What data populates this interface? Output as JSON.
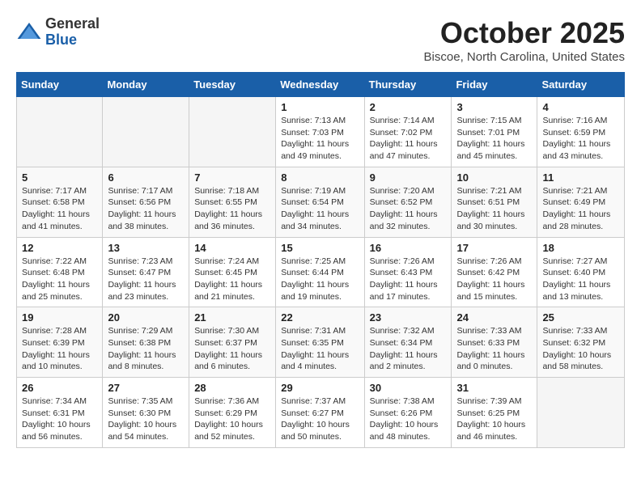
{
  "logo": {
    "general": "General",
    "blue": "Blue"
  },
  "title": "October 2025",
  "location": "Biscoe, North Carolina, United States",
  "days_of_week": [
    "Sunday",
    "Monday",
    "Tuesday",
    "Wednesday",
    "Thursday",
    "Friday",
    "Saturday"
  ],
  "weeks": [
    [
      {
        "day": "",
        "info": ""
      },
      {
        "day": "",
        "info": ""
      },
      {
        "day": "",
        "info": ""
      },
      {
        "day": "1",
        "info": "Sunrise: 7:13 AM\nSunset: 7:03 PM\nDaylight: 11 hours and 49 minutes."
      },
      {
        "day": "2",
        "info": "Sunrise: 7:14 AM\nSunset: 7:02 PM\nDaylight: 11 hours and 47 minutes."
      },
      {
        "day": "3",
        "info": "Sunrise: 7:15 AM\nSunset: 7:01 PM\nDaylight: 11 hours and 45 minutes."
      },
      {
        "day": "4",
        "info": "Sunrise: 7:16 AM\nSunset: 6:59 PM\nDaylight: 11 hours and 43 minutes."
      }
    ],
    [
      {
        "day": "5",
        "info": "Sunrise: 7:17 AM\nSunset: 6:58 PM\nDaylight: 11 hours and 41 minutes."
      },
      {
        "day": "6",
        "info": "Sunrise: 7:17 AM\nSunset: 6:56 PM\nDaylight: 11 hours and 38 minutes."
      },
      {
        "day": "7",
        "info": "Sunrise: 7:18 AM\nSunset: 6:55 PM\nDaylight: 11 hours and 36 minutes."
      },
      {
        "day": "8",
        "info": "Sunrise: 7:19 AM\nSunset: 6:54 PM\nDaylight: 11 hours and 34 minutes."
      },
      {
        "day": "9",
        "info": "Sunrise: 7:20 AM\nSunset: 6:52 PM\nDaylight: 11 hours and 32 minutes."
      },
      {
        "day": "10",
        "info": "Sunrise: 7:21 AM\nSunset: 6:51 PM\nDaylight: 11 hours and 30 minutes."
      },
      {
        "day": "11",
        "info": "Sunrise: 7:21 AM\nSunset: 6:49 PM\nDaylight: 11 hours and 28 minutes."
      }
    ],
    [
      {
        "day": "12",
        "info": "Sunrise: 7:22 AM\nSunset: 6:48 PM\nDaylight: 11 hours and 25 minutes."
      },
      {
        "day": "13",
        "info": "Sunrise: 7:23 AM\nSunset: 6:47 PM\nDaylight: 11 hours and 23 minutes."
      },
      {
        "day": "14",
        "info": "Sunrise: 7:24 AM\nSunset: 6:45 PM\nDaylight: 11 hours and 21 minutes."
      },
      {
        "day": "15",
        "info": "Sunrise: 7:25 AM\nSunset: 6:44 PM\nDaylight: 11 hours and 19 minutes."
      },
      {
        "day": "16",
        "info": "Sunrise: 7:26 AM\nSunset: 6:43 PM\nDaylight: 11 hours and 17 minutes."
      },
      {
        "day": "17",
        "info": "Sunrise: 7:26 AM\nSunset: 6:42 PM\nDaylight: 11 hours and 15 minutes."
      },
      {
        "day": "18",
        "info": "Sunrise: 7:27 AM\nSunset: 6:40 PM\nDaylight: 11 hours and 13 minutes."
      }
    ],
    [
      {
        "day": "19",
        "info": "Sunrise: 7:28 AM\nSunset: 6:39 PM\nDaylight: 11 hours and 10 minutes."
      },
      {
        "day": "20",
        "info": "Sunrise: 7:29 AM\nSunset: 6:38 PM\nDaylight: 11 hours and 8 minutes."
      },
      {
        "day": "21",
        "info": "Sunrise: 7:30 AM\nSunset: 6:37 PM\nDaylight: 11 hours and 6 minutes."
      },
      {
        "day": "22",
        "info": "Sunrise: 7:31 AM\nSunset: 6:35 PM\nDaylight: 11 hours and 4 minutes."
      },
      {
        "day": "23",
        "info": "Sunrise: 7:32 AM\nSunset: 6:34 PM\nDaylight: 11 hours and 2 minutes."
      },
      {
        "day": "24",
        "info": "Sunrise: 7:33 AM\nSunset: 6:33 PM\nDaylight: 11 hours and 0 minutes."
      },
      {
        "day": "25",
        "info": "Sunrise: 7:33 AM\nSunset: 6:32 PM\nDaylight: 10 hours and 58 minutes."
      }
    ],
    [
      {
        "day": "26",
        "info": "Sunrise: 7:34 AM\nSunset: 6:31 PM\nDaylight: 10 hours and 56 minutes."
      },
      {
        "day": "27",
        "info": "Sunrise: 7:35 AM\nSunset: 6:30 PM\nDaylight: 10 hours and 54 minutes."
      },
      {
        "day": "28",
        "info": "Sunrise: 7:36 AM\nSunset: 6:29 PM\nDaylight: 10 hours and 52 minutes."
      },
      {
        "day": "29",
        "info": "Sunrise: 7:37 AM\nSunset: 6:27 PM\nDaylight: 10 hours and 50 minutes."
      },
      {
        "day": "30",
        "info": "Sunrise: 7:38 AM\nSunset: 6:26 PM\nDaylight: 10 hours and 48 minutes."
      },
      {
        "day": "31",
        "info": "Sunrise: 7:39 AM\nSunset: 6:25 PM\nDaylight: 10 hours and 46 minutes."
      },
      {
        "day": "",
        "info": ""
      }
    ]
  ]
}
